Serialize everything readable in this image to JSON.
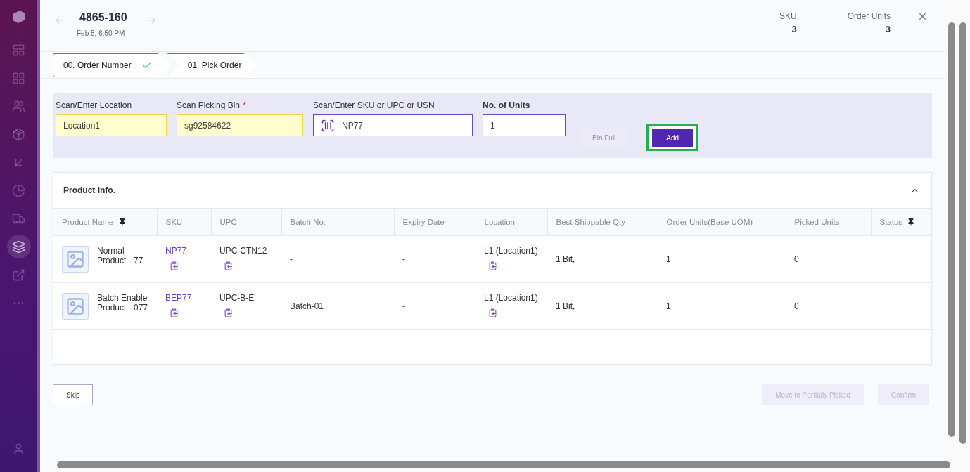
{
  "sidebar": {
    "items": [
      {
        "selected": false
      },
      {
        "selected": false
      },
      {
        "selected": false
      },
      {
        "selected": false
      },
      {
        "selected": false
      },
      {
        "selected": false
      },
      {
        "selected": false
      },
      {
        "selected": true
      },
      {
        "selected": false
      },
      {
        "selected": false
      }
    ]
  },
  "header": {
    "title": "4865-160",
    "subtitle": "Feb 5, 6:50 PM",
    "stats": [
      {
        "label": "SKU",
        "value": "3"
      },
      {
        "label": "Order Units",
        "value": "3"
      }
    ]
  },
  "steps": [
    {
      "label": "00. Order Number",
      "completed": true
    },
    {
      "label": "01. Pick Order",
      "completed": false
    }
  ],
  "fields": [
    {
      "kind": "text",
      "label": "Scan/Enter Location",
      "value": "Location1",
      "highlighted": true,
      "bold": false
    },
    {
      "kind": "text",
      "label": "Scan Picking Bin",
      "required_mark": "*",
      "value": "sg92584622",
      "highlighted": true,
      "bold": false
    },
    {
      "kind": "scan",
      "label": "Scan/Enter SKU or UPC or USN",
      "value": "NP77",
      "highlighted": false,
      "bold": false
    },
    {
      "kind": "text",
      "label": "No. of Units",
      "value": "1",
      "highlighted": false,
      "bold": true
    }
  ],
  "actions": [
    {
      "label": "Bin Full",
      "disabled": true,
      "focused": false
    },
    {
      "label": "Add",
      "disabled": false,
      "focused": true
    }
  ],
  "product_info": {
    "title": "Product Info.",
    "expanded": true,
    "columns": [
      {
        "label": "Product Name",
        "pinned": true
      },
      {
        "label": "SKU",
        "pinned": false
      },
      {
        "label": "UPC",
        "pinned": false
      },
      {
        "label": "Batch No.",
        "pinned": false
      },
      {
        "label": "Expiry Date",
        "pinned": false
      },
      {
        "label": "Location",
        "pinned": false
      },
      {
        "label": "Best Shippable Qty",
        "pinned": false
      },
      {
        "label": "Order Units(Base UOM)",
        "pinned": false
      },
      {
        "label": "Picked Units",
        "pinned": false
      },
      {
        "label": "Status",
        "pinned": true
      }
    ],
    "rows": [
      {
        "name": "Normal Product - 77",
        "sku": "NP77",
        "upc": "UPC-CTN12",
        "batch": "-",
        "expiry": "-",
        "location": "L1 (Location1)",
        "best_qty": "1 Bit,",
        "order_units": "1",
        "picked_units": "0"
      },
      {
        "name": "Batch Enable Product - 077",
        "sku": "BEP77",
        "upc": "UPC-B-E",
        "batch": "Batch-01",
        "expiry": "-",
        "location": "L1 (Location1)",
        "best_qty": "1 Bit,",
        "order_units": "1",
        "picked_units": "0"
      }
    ]
  },
  "footer": {
    "buttons": [
      {
        "label": "Skip",
        "disabled": false,
        "primary": false
      },
      {
        "label": "Move to Partially Picked",
        "disabled": true,
        "primary": true
      },
      {
        "label": "Confirm",
        "disabled": true,
        "primary": true
      }
    ]
  }
}
